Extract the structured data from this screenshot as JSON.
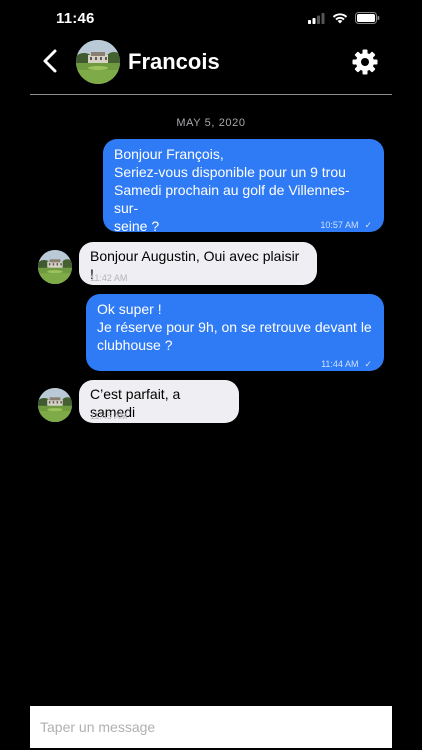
{
  "status_bar": {
    "time": "11:46",
    "icons": [
      "signal-icon",
      "wifi-icon",
      "battery-icon"
    ]
  },
  "header": {
    "contact_name": "Francois",
    "back_icon": "chevron-left-icon",
    "settings_icon": "gear-icon"
  },
  "conversation": {
    "date": "MAY 5, 2020",
    "messages": [
      {
        "direction": "outgoing",
        "lines": [
          "Bonjour François,",
          "Seriez-vous disponible pour un 9 trou",
          "Samedi prochain au golf de Villennes-sur-",
          "seine ?"
        ],
        "time": "10:57 AM",
        "status": "✓"
      },
      {
        "direction": "incoming",
        "lines": [
          "Bonjour Augustin, Oui avec plaisir !"
        ],
        "time": "11:42 AM"
      },
      {
        "direction": "outgoing",
        "lines": [
          "Ok super !",
          "Je réserve pour 9h, on se retrouve devant le",
          "clubhouse ?"
        ],
        "time": "11:44 AM",
        "status": "✓"
      },
      {
        "direction": "incoming",
        "lines": [
          "C’est parfait, a samedi"
        ],
        "time": "11:45 AM"
      }
    ]
  },
  "composer": {
    "placeholder": "Taper un message",
    "value": ""
  },
  "colors": {
    "background": "#000000",
    "outgoing_bubble": "#2f7bf5",
    "incoming_bubble": "#efeff3",
    "divider": "#8e8e93"
  }
}
